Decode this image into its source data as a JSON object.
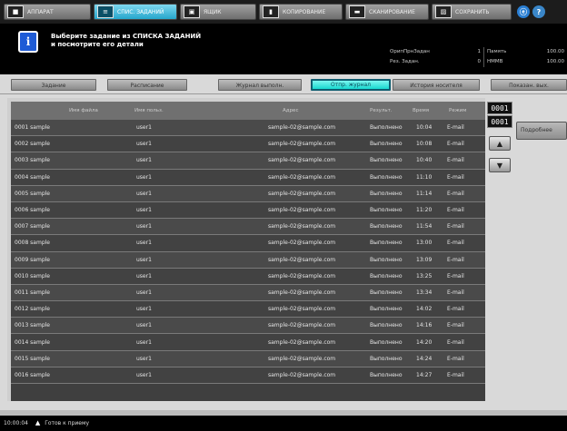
{
  "top_tabs": [
    {
      "icon": "user-icon",
      "label": "АППАРАТ"
    },
    {
      "icon": "job-list-icon",
      "label": "СПИС. ЗАДАНИЙ"
    },
    {
      "icon": "folder-icon",
      "label": "ЯЩИК"
    },
    {
      "icon": "copy-icon",
      "label": "КОПИРОВАНИЕ"
    },
    {
      "icon": "scan-icon",
      "label": "СКАНИРОВАНИЕ"
    },
    {
      "icon": "save-icon",
      "label": "СОХРАНИТЬ"
    }
  ],
  "active_tab_index": 1,
  "round_buttons": {
    "globe": "ⓔ",
    "help": "?"
  },
  "message": {
    "line1": "Выберите задание из СПИСКА ЗАДАНИЙ",
    "line2": "и посмотрите его детали"
  },
  "status": {
    "row1": {
      "label1": "ОрипПрнЗадан",
      "value1": "1",
      "label2": "Память",
      "value2": "100.00"
    },
    "row2": {
      "label1": "Рез. Задан.",
      "value1": "0",
      "label2": "HMMB",
      "value2": "100.00"
    }
  },
  "sub_tabs": [
    "Задание",
    "Расписание",
    "Журнал выполн.",
    "Отпр. журнал",
    "История носителя",
    "Показан. вых."
  ],
  "active_subtab_index": 3,
  "table": {
    "headers": {
      "name": "Имя файла",
      "user": "Имя польз.",
      "addr": "Адрес",
      "result": "Результ.",
      "time": "Время",
      "mode": "Режим"
    },
    "rows": [
      {
        "name": "0001 sample",
        "user": "user1",
        "addr": "sample-02@sample.com",
        "result": "Выполнено",
        "time": "10:04",
        "mode": "E-mail"
      },
      {
        "name": "0002 sample",
        "user": "user1",
        "addr": "sample-02@sample.com",
        "result": "Выполнено",
        "time": "10:08",
        "mode": "E-mail"
      },
      {
        "name": "0003 sample",
        "user": "user1",
        "addr": "sample-02@sample.com",
        "result": "Выполнено",
        "time": "10:40",
        "mode": "E-mail"
      },
      {
        "name": "0004 sample",
        "user": "user1",
        "addr": "sample-02@sample.com",
        "result": "Выполнено",
        "time": "11:10",
        "mode": "E-mail"
      },
      {
        "name": "0005 sample",
        "user": "user1",
        "addr": "sample-02@sample.com",
        "result": "Выполнено",
        "time": "11:14",
        "mode": "E-mail"
      },
      {
        "name": "0006 sample",
        "user": "user1",
        "addr": "sample-02@sample.com",
        "result": "Выполнено",
        "time": "11:20",
        "mode": "E-mail"
      },
      {
        "name": "0007 sample",
        "user": "user1",
        "addr": "sample-02@sample.com",
        "result": "Выполнено",
        "time": "11:54",
        "mode": "E-mail"
      },
      {
        "name": "0008 sample",
        "user": "user1",
        "addr": "sample-02@sample.com",
        "result": "Выполнено",
        "time": "13:00",
        "mode": "E-mail"
      },
      {
        "name": "0009 sample",
        "user": "user1",
        "addr": "sample-02@sample.com",
        "result": "Выполнено",
        "time": "13:09",
        "mode": "E-mail"
      },
      {
        "name": "0010 sample",
        "user": "user1",
        "addr": "sample-02@sample.com",
        "result": "Выполнено",
        "time": "13:25",
        "mode": "E-mail"
      },
      {
        "name": "0011 sample",
        "user": "user1",
        "addr": "sample-02@sample.com",
        "result": "Выполнено",
        "time": "13:34",
        "mode": "E-mail"
      },
      {
        "name": "0012 sample",
        "user": "user1",
        "addr": "sample-02@sample.com",
        "result": "Выполнено",
        "time": "14:02",
        "mode": "E-mail"
      },
      {
        "name": "0013 sample",
        "user": "user1",
        "addr": "sample-02@sample.com",
        "result": "Выполнено",
        "time": "14:16",
        "mode": "E-mail"
      },
      {
        "name": "0014 sample",
        "user": "user1",
        "addr": "sample-02@sample.com",
        "result": "Выполнено",
        "time": "14:20",
        "mode": "E-mail"
      },
      {
        "name": "0015 sample",
        "user": "user1",
        "addr": "sample-02@sample.com",
        "result": "Выполнено",
        "time": "14:24",
        "mode": "E-mail"
      },
      {
        "name": "0016 sample",
        "user": "user1",
        "addr": "sample-02@sample.com",
        "result": "Выполнено",
        "time": "14:27",
        "mode": "E-mail"
      }
    ]
  },
  "pager": {
    "current": "0001",
    "total": "0001"
  },
  "details_button": "Подробнее",
  "statusbar": {
    "time": "10:00:04",
    "text": "Готов к приему"
  },
  "colors": {
    "accent": "#26a6cc",
    "active_subtab": "#17d8cf",
    "info_icon": "#1e5bd6"
  }
}
